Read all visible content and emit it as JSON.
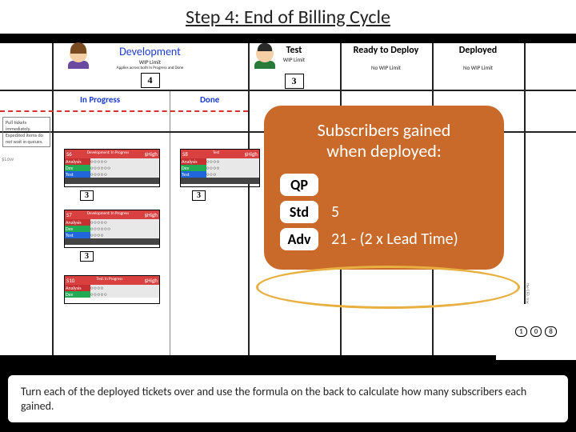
{
  "title": "Step 4: End of Billing Cycle",
  "columns": {
    "dev": {
      "label": "Development",
      "wip_label": "WIP Limit",
      "wip_sub": "Applies across both In Progress and Done",
      "wip_value": "4",
      "sub_left": "In Progress",
      "sub_right": "Done"
    },
    "test": {
      "label": "Test",
      "wip_label": "WIP Limit",
      "wip_value": "3"
    },
    "ready": {
      "label": "Ready to Deploy",
      "wip_label": "No WIP Limit"
    },
    "deployed": {
      "label": "Deployed",
      "wip_label": "No WIP Limit"
    }
  },
  "note": "Pull tickets immediately. Expedited items do not wait in queues.",
  "tickets": {
    "s_low": "$Low",
    "s6": {
      "id": "S6",
      "sub": "Development: In Progress",
      "prio": "$High",
      "an": "Analysis",
      "dev": "Dev",
      "test": "Test"
    },
    "s7": {
      "id": "S7",
      "sub": "Development: In Progress",
      "prio": "$High"
    },
    "s8": {
      "id": "S8",
      "sub": "Test",
      "prio": "$High"
    },
    "s10": {
      "id": "S10",
      "sub": "Test: In Progress",
      "prio": "$High"
    },
    "mini1": "3",
    "mini2": "3",
    "mini3": "3"
  },
  "overlay": {
    "title_l1": "Subscribers gained",
    "title_l2": "when deployed:",
    "rows": [
      {
        "tag": "QP",
        "val": ""
      },
      {
        "tag": "Std",
        "val": "5"
      },
      {
        "tag": "Adv",
        "val": "21 - (2 x Lead Time)"
      }
    ]
  },
  "side_chips": [
    "1",
    "0",
    "8"
  ],
  "caption": "Turn each of the deployed tickets over and use the formula on the back to calculate how many subscribers each gained."
}
